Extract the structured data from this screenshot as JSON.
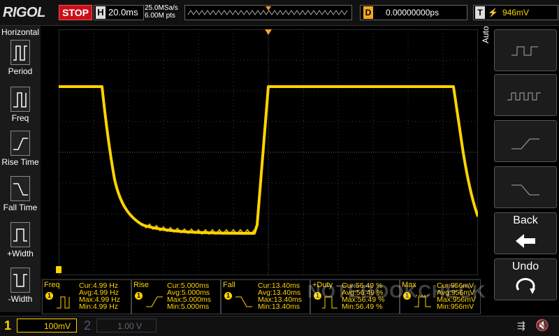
{
  "brand": "RIGOL",
  "run_state": "STOP",
  "horizontal": {
    "key": "H",
    "timebase": "20.0ms"
  },
  "acquisition": {
    "sample_rate": "25.0MSa/s",
    "memory": "6.00M pts"
  },
  "delay": {
    "key": "D",
    "value": "0.00000000ps"
  },
  "trigger": {
    "key": "T",
    "edge_icon": "rising-edge-icon",
    "level": "946mV"
  },
  "left_menu": {
    "title": "Horizontal",
    "items": [
      {
        "label": "Period",
        "icon": "period-icon"
      },
      {
        "label": "Freq",
        "icon": "frequency-icon"
      },
      {
        "label": "Rise Time",
        "icon": "rise-time-icon"
      },
      {
        "label": "Fall Time",
        "icon": "fall-time-icon"
      },
      {
        "label": "+Width",
        "icon": "positive-width-icon"
      },
      {
        "label": "-Width",
        "icon": "negative-width-icon"
      }
    ]
  },
  "right_menu": {
    "auto_label": "Auto",
    "back_label": "Back",
    "undo_label": "Undo"
  },
  "measurements": [
    {
      "name": "Freq",
      "channel": "1",
      "cur": "Cur:4.99 Hz",
      "avg": "Avg:4.99 Hz",
      "max": "Max:4.99 Hz",
      "min": "Min:4.99 Hz"
    },
    {
      "name": "Rise",
      "channel": "1",
      "cur": "Cur:5.000ms",
      "avg": "Avg:5.000ms",
      "max": "Max:5.000ms",
      "min": "Min:5.000ms"
    },
    {
      "name": "Fall",
      "channel": "1",
      "cur": "Cur:13.40ms",
      "avg": "Avg:13.40ms",
      "max": "Max:13.40ms",
      "min": "Min:13.40ms"
    },
    {
      "name": "+Duty",
      "channel": "1",
      "cur": "Cur:56.49 %",
      "avg": "Avg:56.49 %",
      "max": "Max:56.49 %",
      "min": "Min:56.49 %"
    },
    {
      "name": "Max",
      "channel": "1",
      "cur": "Cur:956mV",
      "avg": "Avg:956mV",
      "max": "Max:956mV",
      "min": "Min:956mV"
    }
  ],
  "channels": [
    {
      "number": "1",
      "scale": "100mV"
    },
    {
      "number": "2",
      "scale": "1.00 V"
    }
  ],
  "watermark": "NOTEBOOKCHECK",
  "colors": {
    "ch1": "#ffd400",
    "stop": "#c8101a",
    "delay": "#f5a623"
  }
}
